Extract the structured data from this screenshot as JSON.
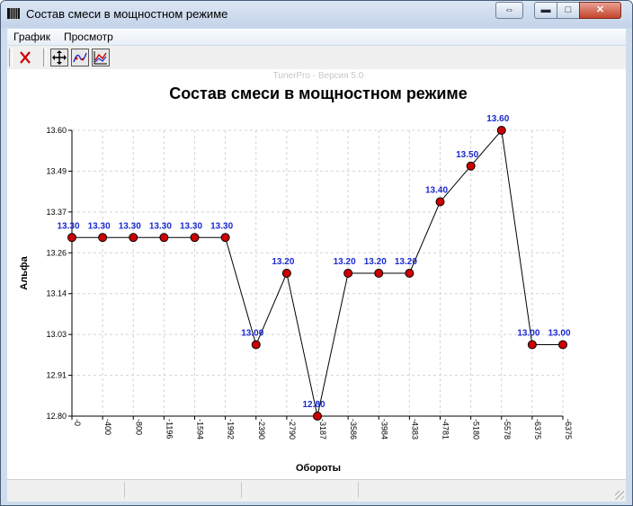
{
  "window": {
    "title": "Состав смеси в мощностном режиме"
  },
  "menu": {
    "items": [
      "График",
      "Просмотр"
    ]
  },
  "toolbar": {
    "buttons": [
      {
        "name": "close-chart-button",
        "icon": "red-x-icon",
        "color": "#d00000"
      },
      {
        "name": "move-tool-button",
        "icon": "move-arrows-icon",
        "pressed": true
      },
      {
        "name": "curve-tool-button",
        "icon": "curve-icon",
        "pressed": true
      },
      {
        "name": "chart-tool-button",
        "icon": "chart-icon",
        "pressed": true
      }
    ]
  },
  "chart_data": {
    "type": "line",
    "watermark": "TunerPro - Версия 5.0",
    "title": "Состав смеси в мощностном режиме",
    "xlabel": "Обороты",
    "ylabel": "Альфа",
    "x_ticks": [
      "0",
      "400",
      "800",
      "1196",
      "1594",
      "1992",
      "2390",
      "2790",
      "3187",
      "3586",
      "3984",
      "4383",
      "4781",
      "5180",
      "5578",
      "6375",
      "6375"
    ],
    "y_ticks": [
      "12.80",
      "12.91",
      "13.03",
      "13.14",
      "13.26",
      "13.37",
      "13.49",
      "13.60"
    ],
    "ylim": [
      12.8,
      13.6
    ],
    "values": [
      13.3,
      13.3,
      13.3,
      13.3,
      13.3,
      13.3,
      13.0,
      13.2,
      12.8,
      13.2,
      13.2,
      13.2,
      13.4,
      13.5,
      13.6,
      13.0,
      13.0
    ],
    "data_labels": [
      "13.30",
      "13.30",
      "13.30",
      "13.30",
      "13.30",
      "13.30",
      "13.00",
      "13.20",
      "12.80",
      "13.20",
      "13.20",
      "13.20",
      "13.40",
      "13.50",
      "13.60",
      "13.00",
      "13.00"
    ],
    "grid": true,
    "line_color": "#000000",
    "marker_color": "#cc0000",
    "label_color": "#1a2ad0"
  }
}
